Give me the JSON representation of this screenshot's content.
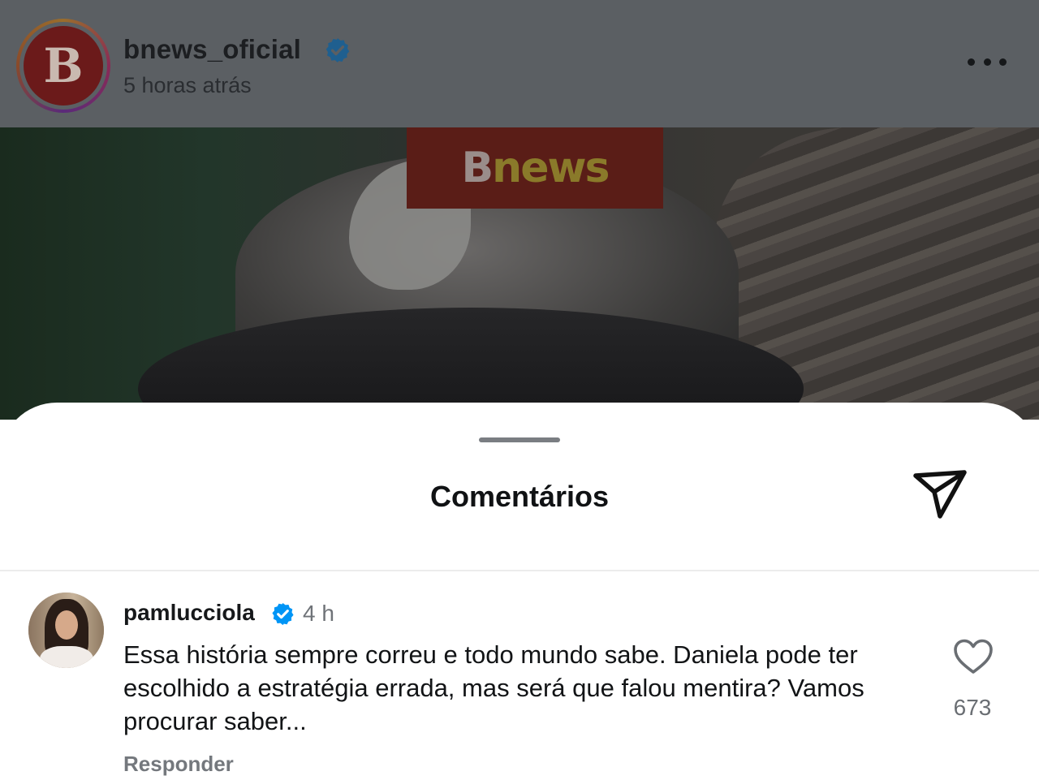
{
  "post": {
    "account_name": "bnews_oficial",
    "time_ago": "5 horas atrás",
    "avatar_letter": "B",
    "image_logo_b": "B",
    "image_logo_news": "news"
  },
  "comments_sheet": {
    "title": "Comentários"
  },
  "comments": [
    {
      "username": "pamlucciola",
      "time": "4 h",
      "text": "Essa história sempre correu e todo mundo sabe. Daniela pode ter escolhido a estratégia errada, mas será que falou mentira? Vamos procurar saber...",
      "reply_label": "Responder",
      "likes": "673"
    }
  ],
  "colors": {
    "verified": "#0095f6",
    "brand_red": "#6b1a1a"
  },
  "icons": [
    "verified-badge-icon",
    "more-options-icon",
    "share-icon",
    "heart-icon"
  ]
}
